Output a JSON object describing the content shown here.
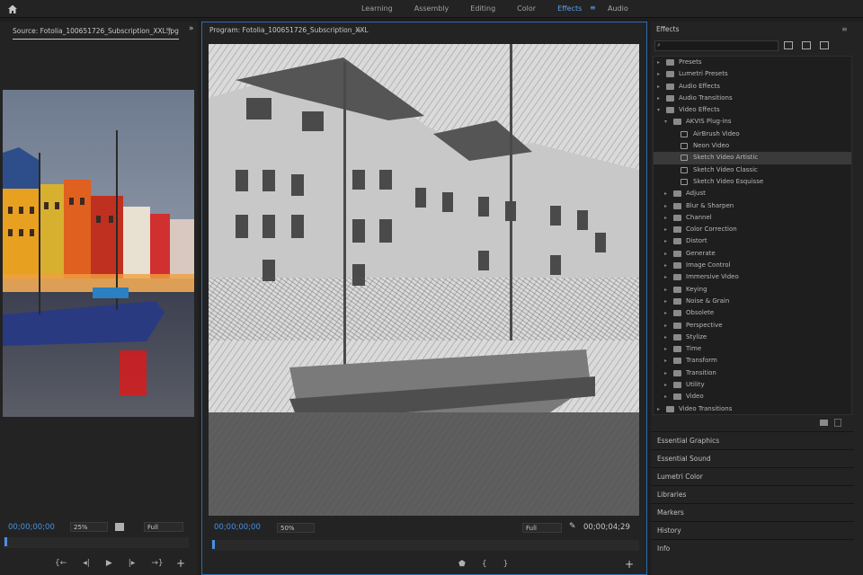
{
  "workspaces": {
    "tabs": [
      "Learning",
      "Assembly",
      "Editing",
      "Color",
      "Effects",
      "Audio"
    ],
    "active": "Effects"
  },
  "source": {
    "title": "Source: Fotolia_100651726_Subscription_XXL.jpg",
    "timecode": "00;00;00;00",
    "zoom": "25%",
    "quality": "Full"
  },
  "program": {
    "title": "Program: Fotolia_100651726_Subscription_XXL",
    "timecode": "00;00;00;00",
    "zoom": "50%",
    "quality": "Full",
    "duration": "00;00;04;29"
  },
  "effects": {
    "title": "Effects",
    "search_placeholder": "",
    "tree": [
      {
        "label": "Presets",
        "level": 0,
        "type": "folder-star",
        "open": false
      },
      {
        "label": "Lumetri Presets",
        "level": 0,
        "type": "folder-star",
        "open": false
      },
      {
        "label": "Audio Effects",
        "level": 0,
        "type": "folder",
        "open": false
      },
      {
        "label": "Audio Transitions",
        "level": 0,
        "type": "folder",
        "open": false
      },
      {
        "label": "Video Effects",
        "level": 0,
        "type": "folder",
        "open": true
      },
      {
        "label": "AKVIS Plug-ins",
        "level": 1,
        "type": "folder",
        "open": true
      },
      {
        "label": "AirBrush Video",
        "level": 2,
        "type": "fx"
      },
      {
        "label": "Neon Video",
        "level": 2,
        "type": "fx"
      },
      {
        "label": "Sketch Video Artistic",
        "level": 2,
        "type": "fx",
        "selected": true
      },
      {
        "label": "Sketch Video Classic",
        "level": 2,
        "type": "fx"
      },
      {
        "label": "Sketch Video Esquisse",
        "level": 2,
        "type": "fx"
      },
      {
        "label": "Adjust",
        "level": 1,
        "type": "folder",
        "open": false
      },
      {
        "label": "Blur & Sharpen",
        "level": 1,
        "type": "folder",
        "open": false
      },
      {
        "label": "Channel",
        "level": 1,
        "type": "folder",
        "open": false
      },
      {
        "label": "Color Correction",
        "level": 1,
        "type": "folder",
        "open": false
      },
      {
        "label": "Distort",
        "level": 1,
        "type": "folder",
        "open": false
      },
      {
        "label": "Generate",
        "level": 1,
        "type": "folder",
        "open": false
      },
      {
        "label": "Image Control",
        "level": 1,
        "type": "folder",
        "open": false
      },
      {
        "label": "Immersive Video",
        "level": 1,
        "type": "folder",
        "open": false
      },
      {
        "label": "Keying",
        "level": 1,
        "type": "folder",
        "open": false
      },
      {
        "label": "Noise & Grain",
        "level": 1,
        "type": "folder",
        "open": false
      },
      {
        "label": "Obsolete",
        "level": 1,
        "type": "folder",
        "open": false
      },
      {
        "label": "Perspective",
        "level": 1,
        "type": "folder",
        "open": false
      },
      {
        "label": "Stylize",
        "level": 1,
        "type": "folder",
        "open": false
      },
      {
        "label": "Time",
        "level": 1,
        "type": "folder",
        "open": false
      },
      {
        "label": "Transform",
        "level": 1,
        "type": "folder",
        "open": false
      },
      {
        "label": "Transition",
        "level": 1,
        "type": "folder",
        "open": false
      },
      {
        "label": "Utility",
        "level": 1,
        "type": "folder",
        "open": false
      },
      {
        "label": "Video",
        "level": 1,
        "type": "folder",
        "open": false
      },
      {
        "label": "Video Transitions",
        "level": 0,
        "type": "folder",
        "open": false
      }
    ]
  },
  "side_panels": [
    "Essential Graphics",
    "Essential Sound",
    "Lumetri Color",
    "Libraries",
    "Markers",
    "History",
    "Info"
  ],
  "colors": {
    "accent": "#4a90e2",
    "panel": "#232323",
    "background": "#1e1e1e"
  }
}
